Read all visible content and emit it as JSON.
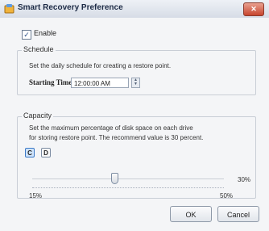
{
  "window": {
    "title": "Smart Recovery Preference",
    "close_glyph": "✕",
    "icon": "app-icon"
  },
  "enable": {
    "label": "Enable",
    "checked": true,
    "check_glyph": "✓"
  },
  "schedule": {
    "title": "Schedule",
    "description": "Set the daily schedule for creating a restore point.",
    "start_label": "Starting Time :",
    "start_value": "12:00:00 AM"
  },
  "capacity": {
    "title": "Capacity",
    "description_line1": "Set the maximum percentage of disk space on each drive",
    "description_line2": "for storing restore point.  The recommend value is 30 percent.",
    "drives": [
      "C",
      "D"
    ],
    "selected_drive": "C",
    "slider": {
      "min_label": "15%",
      "max_label": "50%",
      "value_label": "30%",
      "min": 15,
      "max": 50,
      "value": 30
    }
  },
  "buttons": {
    "ok": "OK",
    "cancel": "Cancel"
  }
}
